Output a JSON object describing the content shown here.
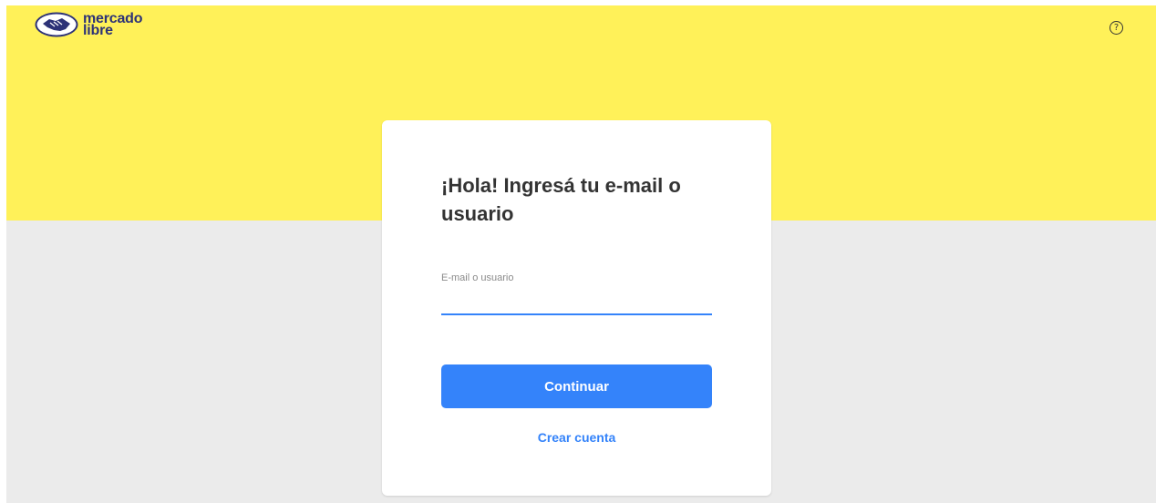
{
  "header": {
    "brand_line1": "mercado",
    "brand_line2": "libre",
    "help_icon": "help-circle-icon",
    "help_glyph": "?",
    "logo_icon": "handshake-logo-icon"
  },
  "login": {
    "title": "¡Hola! Ingresá tu e-mail o usuario",
    "field_label": "E-mail o usuario",
    "field_value": "",
    "continue_label": "Continuar",
    "create_account_label": "Crear cuenta"
  },
  "colors": {
    "header_bg": "#fff159",
    "page_bg": "#ebebeb",
    "primary": "#3483fa",
    "brand_text": "#2d3277"
  }
}
